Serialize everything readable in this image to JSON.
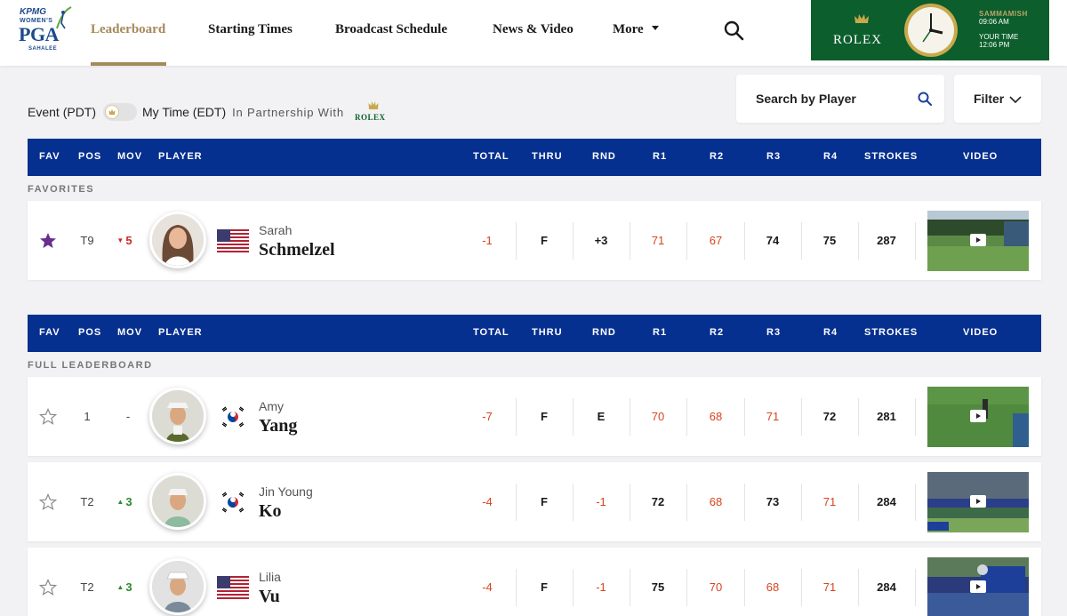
{
  "nav": {
    "logo": {
      "line1": "KPMG",
      "line2": "WOMEN'S",
      "line3": "PGA",
      "line4": "SAHALEE"
    },
    "items": [
      {
        "label": "Leaderboard",
        "active": true
      },
      {
        "label": "Starting Times"
      },
      {
        "label": "Broadcast Schedule"
      },
      {
        "label": "News & Video"
      },
      {
        "label": "More"
      }
    ],
    "search_icon": "search-icon"
  },
  "ad": {
    "brand": "ROLEX",
    "location": "SAMMAMISH",
    "local_time": "09:06 AM",
    "your_time_label": "YOUR TIME",
    "your_time": "12:06 PM"
  },
  "controls": {
    "event_label": "Event (PDT)",
    "my_time_label": "My Time (EDT)",
    "partnership": "In Partnership With",
    "partner_brand": "ROLEX",
    "search_placeholder": "Search by Player",
    "filter_label": "Filter"
  },
  "table": {
    "columns": [
      "FAV",
      "POS",
      "MOV",
      "PLAYER",
      "TOTAL",
      "THRU",
      "RND",
      "R1",
      "R2",
      "R3",
      "R4",
      "STROKES",
      "VIDEO"
    ],
    "favorites_label": "FAVORITES",
    "full_label": "FULL LEADERBOARD"
  },
  "favorites": [
    {
      "fav": true,
      "pos": "T9",
      "mov": "5",
      "mov_dir": "down",
      "first": "Sarah",
      "last": "Schmelzel",
      "country": "USA",
      "total": "-1",
      "thru": "F",
      "rnd": "+3",
      "r1": "71",
      "r2": "67",
      "r3": "74",
      "r4": "75",
      "strokes": "287",
      "under": [
        true,
        false,
        false,
        true,
        true,
        false,
        false
      ]
    }
  ],
  "leaderboard": [
    {
      "fav": false,
      "pos": "1",
      "mov": "-",
      "mov_dir": "none",
      "first": "Amy",
      "last": "Yang",
      "country": "KOR",
      "total": "-7",
      "thru": "F",
      "rnd": "E",
      "r1": "70",
      "r2": "68",
      "r3": "71",
      "r4": "72",
      "strokes": "281",
      "under": [
        true,
        false,
        false,
        true,
        true,
        true,
        false
      ]
    },
    {
      "fav": false,
      "pos": "T2",
      "mov": "3",
      "mov_dir": "up",
      "first": "Jin Young",
      "last": "Ko",
      "country": "KOR",
      "total": "-4",
      "thru": "F",
      "rnd": "-1",
      "r1": "72",
      "r2": "68",
      "r3": "73",
      "r4": "71",
      "strokes": "284",
      "under": [
        true,
        false,
        true,
        false,
        true,
        false,
        true
      ]
    },
    {
      "fav": false,
      "pos": "T2",
      "mov": "3",
      "mov_dir": "up",
      "first": "Lilia",
      "last": "Vu",
      "country": "USA",
      "total": "-4",
      "thru": "F",
      "rnd": "-1",
      "r1": "75",
      "r2": "70",
      "r3": "68",
      "r4": "71",
      "strokes": "284",
      "under": [
        true,
        false,
        true,
        false,
        true,
        true,
        true
      ]
    }
  ],
  "colors": {
    "header_blue": "#06308f",
    "gold": "#a6895a",
    "under_par": "#d9431e",
    "rolex_green": "#0c5e2c",
    "fav_star": "#6b2d8f"
  }
}
